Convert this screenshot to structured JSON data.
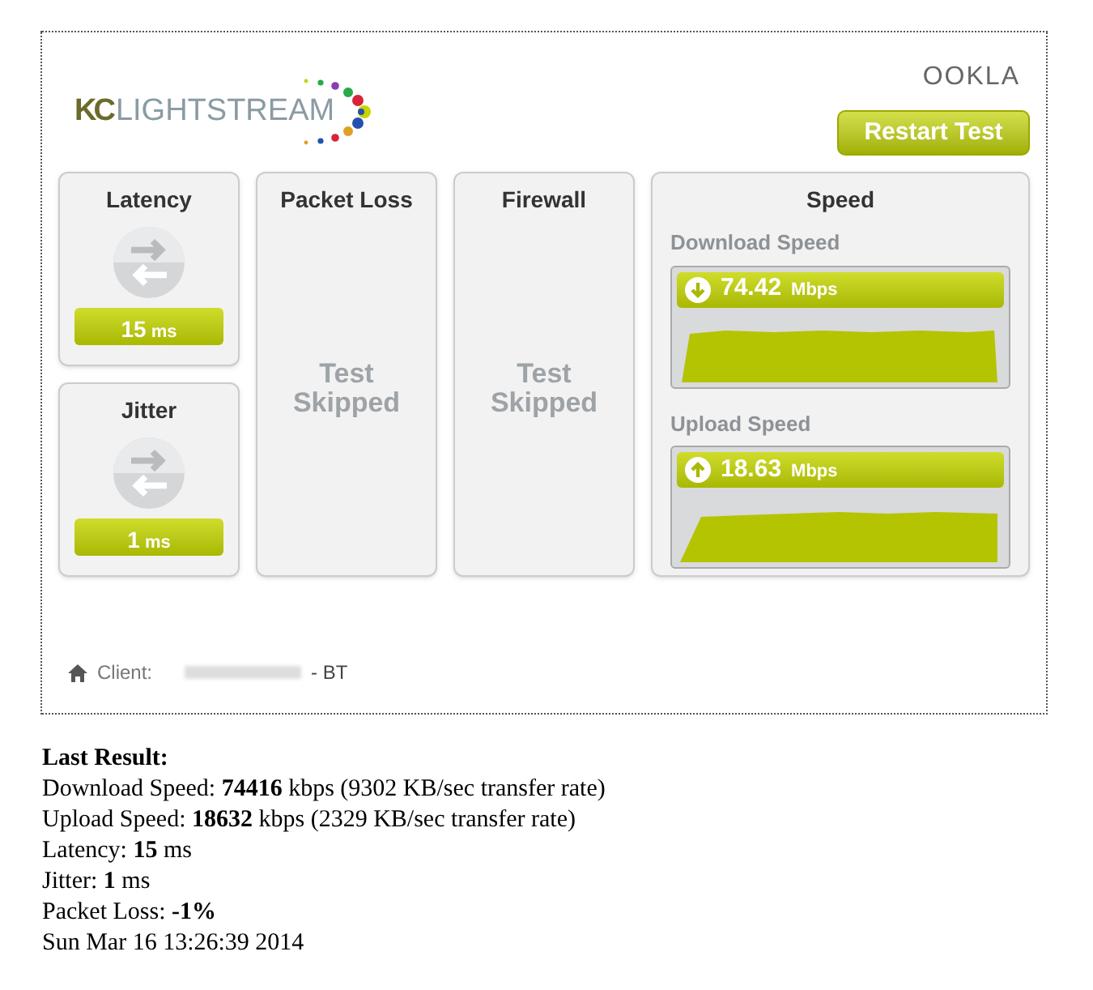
{
  "header": {
    "logo": {
      "prefix": "KC",
      "name": "LIGHTSTREAM"
    },
    "provider_logo": "OOKLA",
    "restart_button": "Restart Test"
  },
  "small_panels": [
    {
      "title": "Latency",
      "value": "15",
      "unit": "ms"
    },
    {
      "title": "Jitter",
      "value": "1",
      "unit": "ms"
    }
  ],
  "skipped_panels": [
    {
      "title": "Packet Loss",
      "message": "Test Skipped"
    },
    {
      "title": "Firewall",
      "message": "Test Skipped"
    }
  ],
  "speed_panel": {
    "title": "Speed",
    "gauges": [
      {
        "kind": "download",
        "label": "Download Speed",
        "value": "74.42",
        "unit": "Mbps"
      },
      {
        "kind": "upload",
        "label": "Upload Speed",
        "value": "18.63",
        "unit": "Mbps"
      }
    ]
  },
  "client": {
    "label": "Client:",
    "suffix": "- BT"
  },
  "last_result": {
    "heading": "Last Result:",
    "lines": [
      "Download Speed: **74416** kbps (9302 KB/sec transfer rate)",
      "Upload Speed: **18632** kbps (2329 KB/sec transfer rate)",
      "Latency: **15** ms",
      "Jitter: **1** ms",
      "Packet Loss: **-1%**",
      "Sun Mar 16 13:26:39 2014"
    ]
  }
}
